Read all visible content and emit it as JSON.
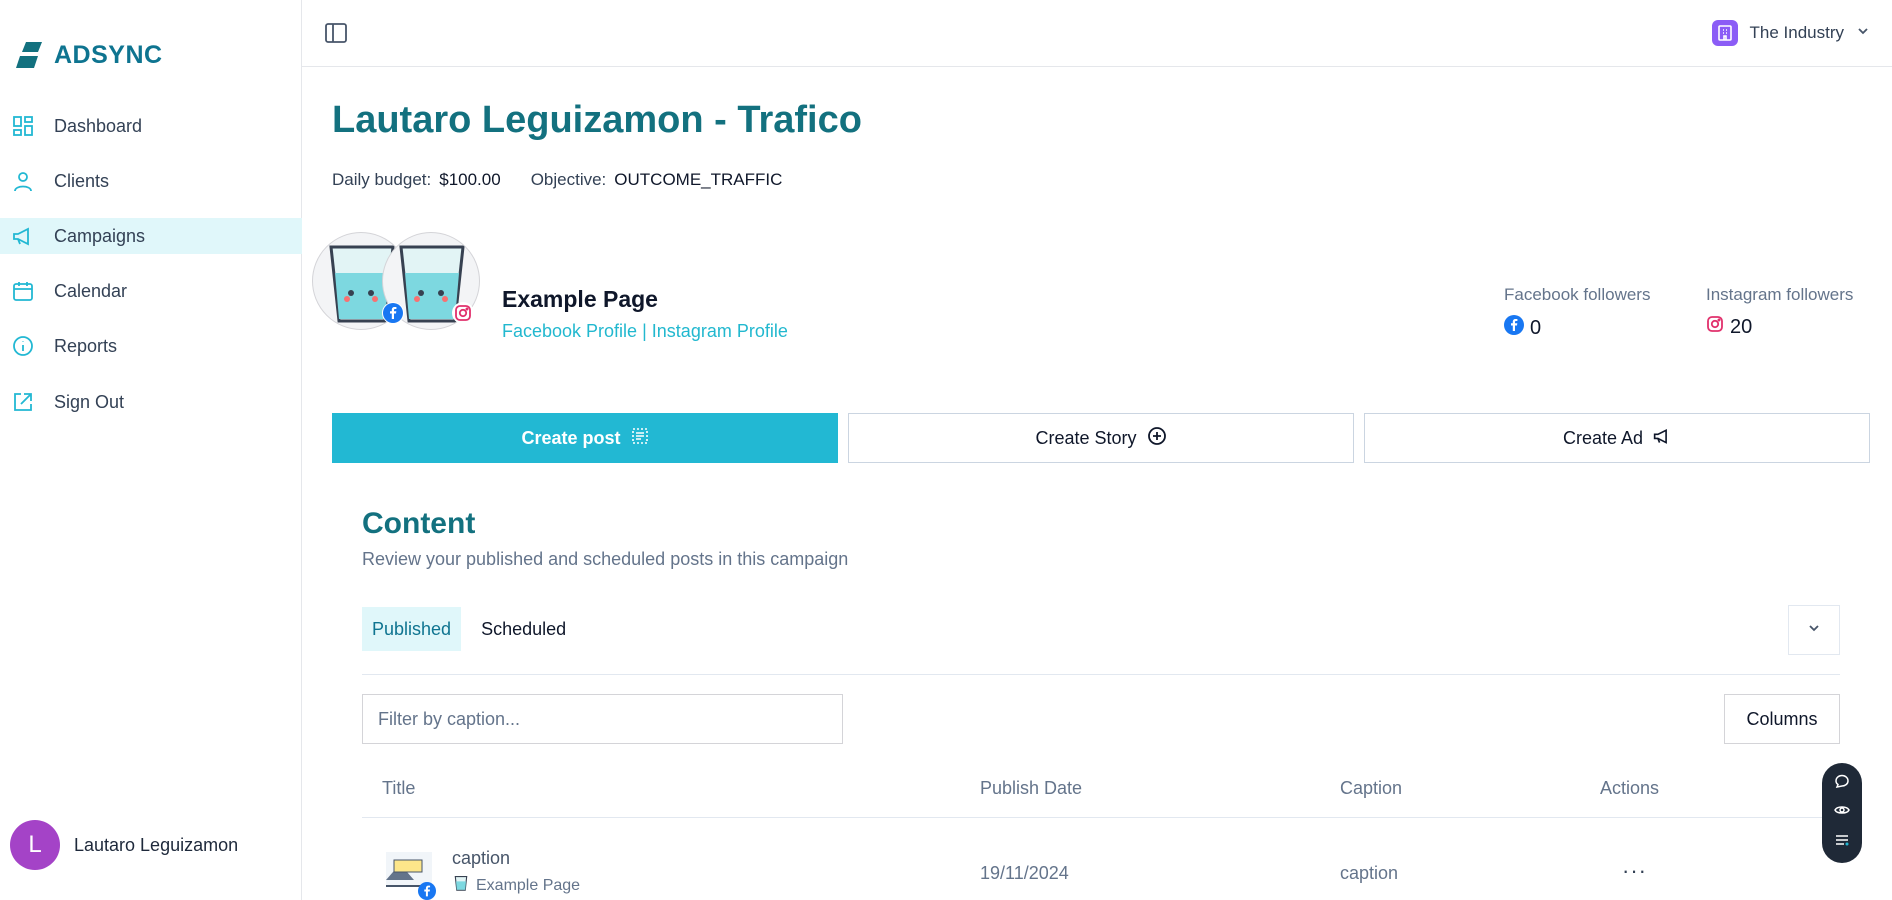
{
  "brand": {
    "name": "ADSYNC",
    "accent": "#13717f",
    "primary": "#22b8d3"
  },
  "sidebar": {
    "items": [
      {
        "label": "Dashboard",
        "icon": "dashboard-icon"
      },
      {
        "label": "Clients",
        "icon": "user-icon"
      },
      {
        "label": "Campaigns",
        "icon": "megaphone-icon",
        "active": true
      },
      {
        "label": "Calendar",
        "icon": "calendar-icon"
      },
      {
        "label": "Reports",
        "icon": "info-icon"
      }
    ],
    "signout": "Sign Out",
    "user": {
      "initial": "L",
      "name": "Lautaro Leguizamon"
    }
  },
  "topbar": {
    "org": "The Industry"
  },
  "campaign": {
    "title": "Lautaro Leguizamon - Trafico",
    "budget_label": "Daily budget:",
    "budget_value": "$100.00",
    "objective_label": "Objective:",
    "objective_value": "OUTCOME_TRAFFIC"
  },
  "page": {
    "name": "Example Page",
    "fb_link": "Facebook Profile",
    "separator": "|",
    "ig_link": "Instagram Profile",
    "fb_followers_label": "Facebook followers",
    "fb_followers": "0",
    "ig_followers_label": "Instagram followers",
    "ig_followers": "20"
  },
  "actions": {
    "create_post": "Create post",
    "create_story": "Create Story",
    "create_ad": "Create Ad"
  },
  "content": {
    "title": "Content",
    "subtitle": "Review your published and scheduled posts in this campaign",
    "tabs": [
      "Published",
      "Scheduled"
    ],
    "filter_placeholder": "Filter by caption...",
    "columns_label": "Columns",
    "headers": [
      "Title",
      "Publish Date",
      "Caption",
      "Actions"
    ],
    "rows": [
      {
        "title": "caption",
        "page": "Example Page",
        "date": "19/11/2024",
        "caption": "caption",
        "actions": "···"
      }
    ]
  }
}
